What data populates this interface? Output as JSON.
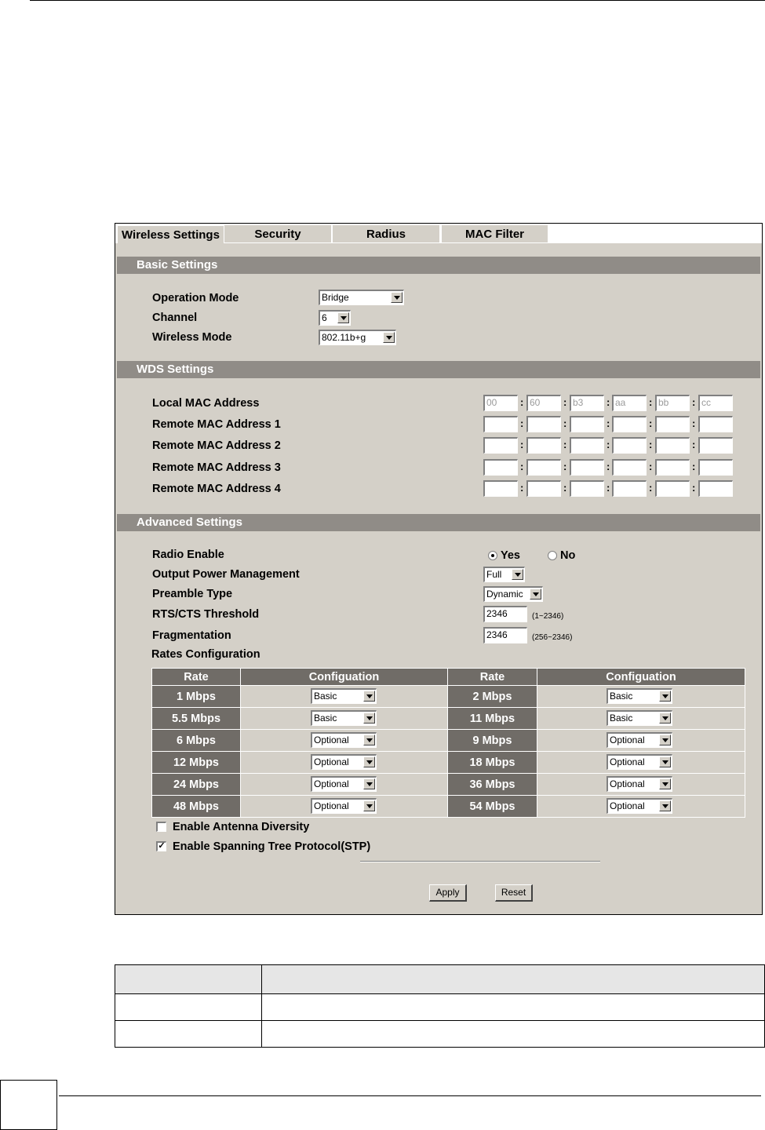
{
  "tabs": [
    "Wireless Settings",
    "Security",
    "Radius",
    "MAC Filter"
  ],
  "basic": {
    "title": "Basic Settings",
    "operation_mode_label": "Operation Mode",
    "operation_mode_value": "Bridge",
    "channel_label": "Channel",
    "channel_value": "6",
    "wireless_mode_label": "Wireless Mode",
    "wireless_mode_value": "802.11b+g"
  },
  "wds": {
    "title": "WDS Settings",
    "local_label": "Local MAC Address",
    "local_octets": [
      "00",
      "60",
      "b3",
      "aa",
      "bb",
      "cc"
    ],
    "remote_labels": [
      "Remote MAC Address 1",
      "Remote MAC Address 2",
      "Remote MAC Address 3",
      "Remote MAC Address 4"
    ]
  },
  "advanced": {
    "title": "Advanced Settings",
    "radio_label": "Radio Enable",
    "radio_yes": "Yes",
    "radio_no": "No",
    "power_label": "Output Power Management",
    "power_value": "Full",
    "preamble_label": "Preamble Type",
    "preamble_value": "Dynamic",
    "rts_label": "RTS/CTS Threshold",
    "rts_value": "2346",
    "rts_hint": "(1~2346)",
    "frag_label": "Fragmentation",
    "frag_value": "2346",
    "frag_hint": "(256~2346)",
    "rates_label": "Rates Configuration",
    "rates_headers": [
      "Rate",
      "Configuation",
      "Rate",
      "Configuation"
    ],
    "rates_rows": [
      {
        "rate1": "1 Mbps",
        "cfg1": "Basic",
        "rate2": "2 Mbps",
        "cfg2": "Basic"
      },
      {
        "rate1": "5.5 Mbps",
        "cfg1": "Basic",
        "rate2": "11 Mbps",
        "cfg2": "Basic"
      },
      {
        "rate1": "6 Mbps",
        "cfg1": "Optional",
        "rate2": "9 Mbps",
        "cfg2": "Optional"
      },
      {
        "rate1": "12 Mbps",
        "cfg1": "Optional",
        "rate2": "18 Mbps",
        "cfg2": "Optional"
      },
      {
        "rate1": "24 Mbps",
        "cfg1": "Optional",
        "rate2": "36 Mbps",
        "cfg2": "Optional"
      },
      {
        "rate1": "48 Mbps",
        "cfg1": "Optional",
        "rate2": "54 Mbps",
        "cfg2": "Optional"
      }
    ],
    "antenna_label": "Enable Antenna Diversity",
    "stp_label": "Enable Spanning Tree Protocol(STP)",
    "apply_label": "Apply",
    "reset_label": "Reset"
  }
}
